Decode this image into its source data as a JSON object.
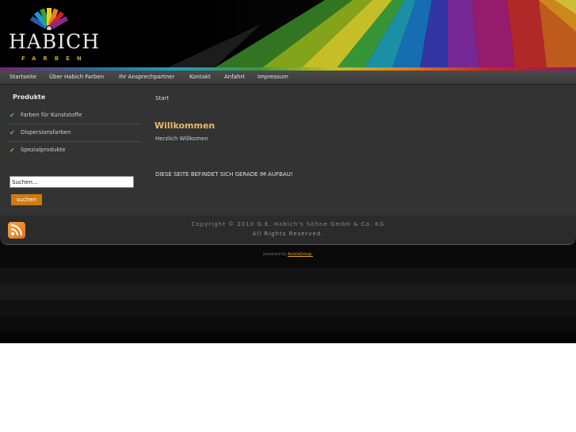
{
  "header": {
    "logo_text": "HABICH",
    "logo_subtext": "FARBEN"
  },
  "nav": {
    "items": [
      {
        "label": "Startseite"
      },
      {
        "label": "Über Habich Farben"
      },
      {
        "label": "Ihr Ansprechpartner"
      },
      {
        "label": "Kontakt"
      },
      {
        "label": "Anfahrt"
      },
      {
        "label": "Impressum"
      }
    ]
  },
  "sidebar": {
    "title": "Produkte",
    "items": [
      {
        "label": "Farben für Kunststoffe"
      },
      {
        "label": "Dispersionsfarben"
      },
      {
        "label": "Spezialprodukte"
      }
    ],
    "search_value": "Suchen...",
    "search_button": "suchen"
  },
  "main": {
    "breadcrumb": "Start",
    "title": "Willkommen",
    "intro": "Herzlich Willkomen",
    "notice": "DIESE SEITE BEFINDET SICH GERADE IM AUFBAU!"
  },
  "footer": {
    "copyright": "Copyright © 2010 G.E. Habich's Söhne GmbH & Co. KG",
    "rights": "All Rights Reserved.",
    "powered_prefix": "powered by",
    "powered_link": "AvistaGroup."
  },
  "icons": {
    "check": "checkmark-icon",
    "rss": "rss-icon"
  },
  "colors": {
    "accent_orange": "#d07a10",
    "title_color": "#e8b870",
    "check_green": "#7ab83a"
  }
}
